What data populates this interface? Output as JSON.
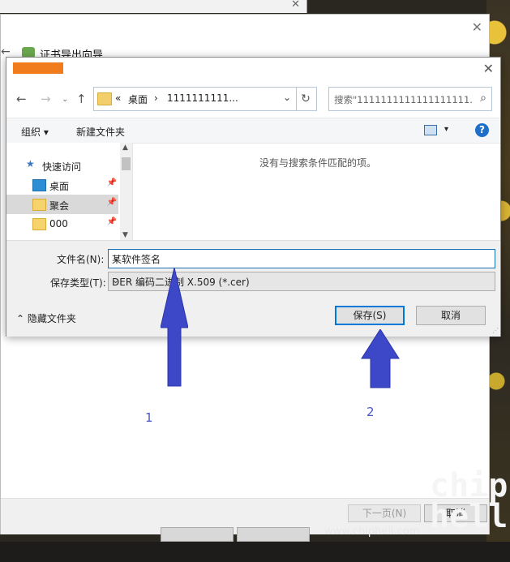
{
  "wizard": {
    "title": "证书导出向导",
    "back_arrow": "←",
    "close": "✕",
    "next_label": "下一页(N)",
    "cancel_label": "取消"
  },
  "dialog": {
    "close": "✕",
    "address": {
      "prefix": "«",
      "segments": [
        "桌面",
        "1111111111..."
      ],
      "separator": "›"
    },
    "search_placeholder": "搜索\"1111111111111111111...",
    "toolbar": {
      "organize": "组织 ▾",
      "new_folder": "新建文件夹",
      "view_caret": "▾",
      "help": "?"
    },
    "nav_pane": {
      "quick_access": "快速访问",
      "items": [
        {
          "label": "桌面",
          "icon": "desktop-icon"
        },
        {
          "label": "聚会",
          "icon": "folder-icon",
          "selected": true
        },
        {
          "label": "000",
          "icon": "folder-icon"
        }
      ]
    },
    "empty_message": "没有与搜索条件匹配的项。",
    "filename_label": "文件名(N):",
    "filename_value": "某软件签名",
    "filetype_label": "保存类型(T):",
    "filetype_value": "DER 编码二进制 X.509 (*.cer)",
    "hide_folders": "隐藏文件夹",
    "save_label": "保存(S)",
    "cancel_label": "取消"
  },
  "annotations": {
    "label_1": "1",
    "label_2": "2",
    "arrow_color": "#3d48c8"
  },
  "watermark": {
    "site": "www.chiphell.com",
    "logo": "chip hell"
  }
}
